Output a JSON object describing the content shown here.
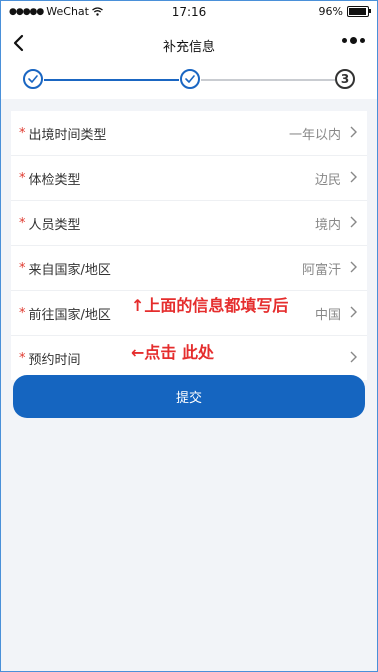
{
  "status": {
    "carrier": "WeChat",
    "time": "17:16",
    "battery_text": "96%",
    "battery_level": 0.96
  },
  "nav": {
    "title": "补充信息"
  },
  "stepper": {
    "steps": [
      {
        "state": "done"
      },
      {
        "state": "done"
      },
      {
        "state": "current",
        "label": "3"
      }
    ],
    "accent": "#1a66c2"
  },
  "form": {
    "rows": [
      {
        "label": "出境时间类型",
        "value": "一年以内"
      },
      {
        "label": "体检类型",
        "value": "边民"
      },
      {
        "label": "人员类型",
        "value": "境内"
      },
      {
        "label": "来自国家/地区",
        "value": "阿富汗"
      },
      {
        "label": "前往国家/地区",
        "value": "中国"
      },
      {
        "label": "预约时间",
        "value": ""
      }
    ],
    "required_mark": "*"
  },
  "annotations": {
    "fill_above": "↑上面的信息都填写后",
    "click_here": "←点击 此处"
  },
  "submit_label": "提交",
  "colors": {
    "primary": "#1565c0",
    "annotation": "#e52d2d",
    "required": "#e0392f"
  }
}
